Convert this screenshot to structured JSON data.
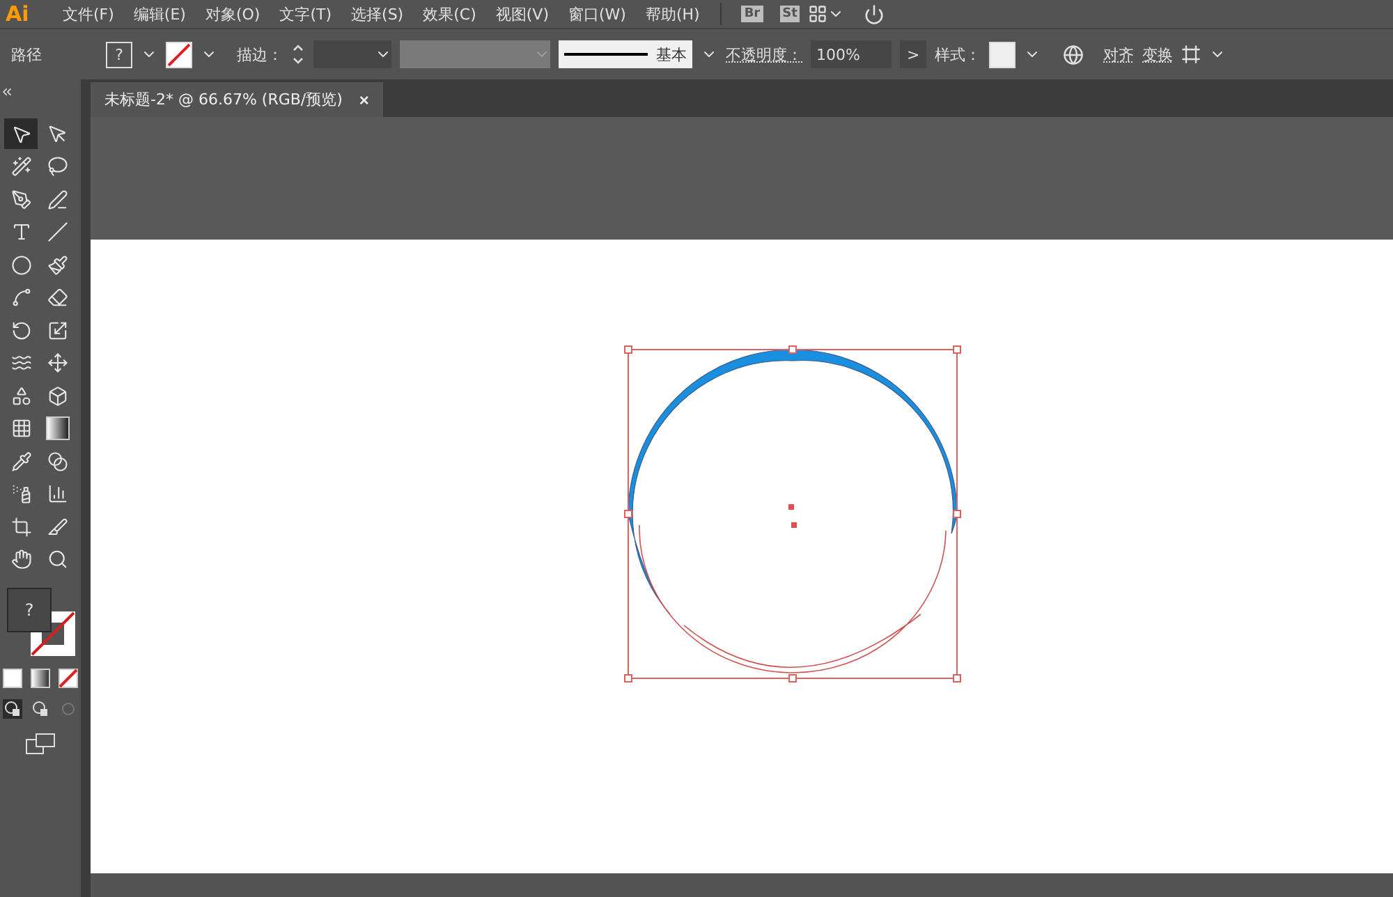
{
  "app": {
    "logo": "Ai",
    "menu": [
      "文件(F)",
      "编辑(E)",
      "对象(O)",
      "文字(T)",
      "选择(S)",
      "效果(C)",
      "视图(V)",
      "窗口(W)",
      "帮助(H)"
    ],
    "bridge": "Br",
    "stock": "St"
  },
  "control_bar": {
    "selection_label": "路径",
    "fill_text": "?",
    "stroke_label": "描边：",
    "brush_name": "基本",
    "opacity_label": "不透明度：",
    "opacity_value": "100%",
    "opacity_more": ">",
    "style_label": "样式：",
    "align": "对齐",
    "transform": "变换"
  },
  "document_tab": {
    "title": "未标题-2* @ 66.67% (RGB/预览)",
    "close": "×",
    "selected": true
  },
  "tools": [
    {
      "kind": "selection",
      "selected": true
    },
    {
      "kind": "direct-selection",
      "selected": false
    },
    {
      "kind": "magic-wand",
      "selected": false
    },
    {
      "kind": "lasso",
      "selected": false
    },
    {
      "kind": "pen",
      "selected": false
    },
    {
      "kind": "curvature",
      "selected": false
    },
    {
      "kind": "type",
      "selected": false
    },
    {
      "kind": "line",
      "selected": false
    },
    {
      "kind": "ellipse",
      "selected": false
    },
    {
      "kind": "paintbrush",
      "selected": false
    },
    {
      "kind": "shaper",
      "selected": false
    },
    {
      "kind": "eraser",
      "selected": false
    },
    {
      "kind": "rotate",
      "selected": false
    },
    {
      "kind": "scale",
      "selected": false
    },
    {
      "kind": "warp",
      "selected": false
    },
    {
      "kind": "free-transform",
      "selected": false
    },
    {
      "kind": "shape-builder",
      "selected": false
    },
    {
      "kind": "perspective",
      "selected": false
    },
    {
      "kind": "mesh",
      "selected": false
    },
    {
      "kind": "gradient",
      "selected": false
    },
    {
      "kind": "eyedropper",
      "selected": false
    },
    {
      "kind": "blend",
      "selected": false
    },
    {
      "kind": "sprayer",
      "selected": false
    },
    {
      "kind": "graph",
      "selected": false
    },
    {
      "kind": "artboard",
      "selected": false
    },
    {
      "kind": "slice",
      "selected": false
    },
    {
      "kind": "hand",
      "selected": false
    },
    {
      "kind": "zoom",
      "selected": false
    }
  ],
  "fill_stroke": {
    "fill_text": "?"
  },
  "artwork": {
    "kind": "crescent",
    "selected": true
  }
}
